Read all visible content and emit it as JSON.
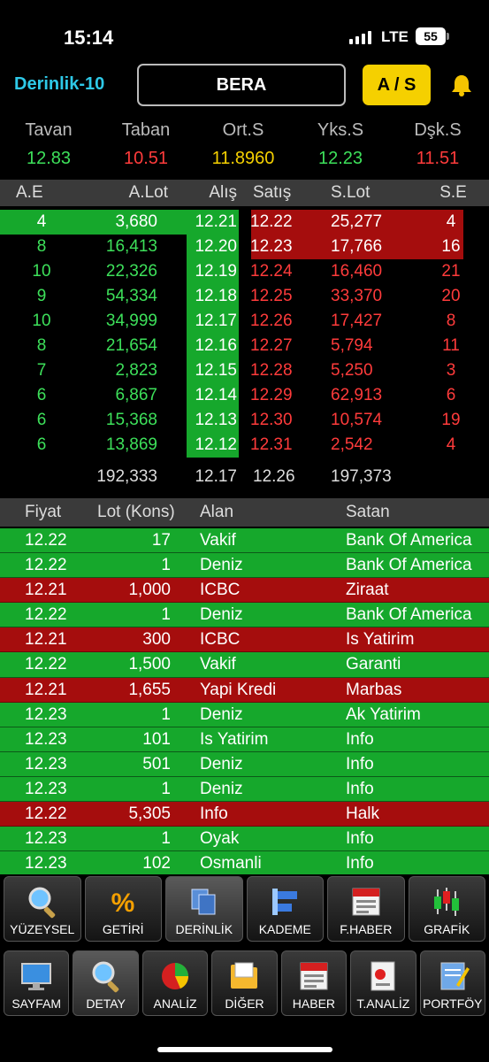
{
  "status": {
    "time": "15:14",
    "network": "LTE",
    "battery": "55"
  },
  "header": {
    "depth_label": "Derinlik-10",
    "symbol": "BERA",
    "buy_sell": "A / S"
  },
  "summary": [
    {
      "label": "Tavan",
      "value": "12.83",
      "color": "#3de05a"
    },
    {
      "label": "Taban",
      "value": "10.51",
      "color": "#ff3b3b"
    },
    {
      "label": "Ort.S",
      "value": "11.8960",
      "color": "#f5d000"
    },
    {
      "label": "Yks.S",
      "value": "12.23",
      "color": "#3de05a"
    },
    {
      "label": "Dşk.S",
      "value": "11.51",
      "color": "#ff3b3b"
    }
  ],
  "depth": {
    "headers": [
      "A.E",
      "A.Lot",
      "Alış",
      "Satış",
      "S.Lot",
      "S.E"
    ],
    "rows": [
      [
        "4",
        "3,680",
        "12.21",
        "12.22",
        "25,277",
        "4"
      ],
      [
        "8",
        "16,413",
        "12.20",
        "12.23",
        "17,766",
        "16"
      ],
      [
        "10",
        "22,326",
        "12.19",
        "12.24",
        "16,460",
        "21"
      ],
      [
        "9",
        "54,334",
        "12.18",
        "12.25",
        "33,370",
        "20"
      ],
      [
        "10",
        "34,999",
        "12.17",
        "12.26",
        "17,427",
        "8"
      ],
      [
        "8",
        "21,654",
        "12.16",
        "12.27",
        "5,794",
        "11"
      ],
      [
        "7",
        "2,823",
        "12.15",
        "12.28",
        "5,250",
        "3"
      ],
      [
        "6",
        "6,867",
        "12.14",
        "12.29",
        "62,913",
        "6"
      ],
      [
        "6",
        "15,368",
        "12.13",
        "12.30",
        "10,574",
        "19"
      ],
      [
        "6",
        "13,869",
        "12.12",
        "12.31",
        "2,542",
        "4"
      ]
    ],
    "bid_fill": [
      1.0,
      0.0,
      0,
      0,
      0,
      0,
      0,
      0,
      0,
      0
    ],
    "ask_fill": [
      1.0,
      1.0,
      0,
      0,
      0,
      0,
      0,
      0,
      0,
      0
    ],
    "totals": [
      "192,333",
      "12.17",
      "12.26",
      "197,373"
    ]
  },
  "trades": {
    "headers": [
      "Fiyat",
      "Lot (Kons)",
      "Alan",
      "Satan"
    ],
    "rows": [
      {
        "side": "buy",
        "price": "12.22",
        "lot": "17",
        "buyer": "Vakif",
        "seller": "Bank Of America"
      },
      {
        "side": "buy",
        "price": "12.22",
        "lot": "1",
        "buyer": "Deniz",
        "seller": "Bank Of America"
      },
      {
        "side": "sell",
        "price": "12.21",
        "lot": "1,000",
        "buyer": "ICBC",
        "seller": "Ziraat"
      },
      {
        "side": "buy",
        "price": "12.22",
        "lot": "1",
        "buyer": "Deniz",
        "seller": "Bank Of America"
      },
      {
        "side": "sell",
        "price": "12.21",
        "lot": "300",
        "buyer": "ICBC",
        "seller": "Is Yatirim"
      },
      {
        "side": "buy",
        "price": "12.22",
        "lot": "1,500",
        "buyer": "Vakif",
        "seller": "Garanti"
      },
      {
        "side": "sell",
        "price": "12.21",
        "lot": "1,655",
        "buyer": "Yapi Kredi",
        "seller": "Marbas"
      },
      {
        "side": "buy",
        "price": "12.23",
        "lot": "1",
        "buyer": "Deniz",
        "seller": "Ak Yatirim"
      },
      {
        "side": "buy",
        "price": "12.23",
        "lot": "101",
        "buyer": "Is Yatirim",
        "seller": "Info"
      },
      {
        "side": "buy",
        "price": "12.23",
        "lot": "501",
        "buyer": "Deniz",
        "seller": "Info"
      },
      {
        "side": "buy",
        "price": "12.23",
        "lot": "1",
        "buyer": "Deniz",
        "seller": "Info"
      },
      {
        "side": "sell",
        "price": "12.22",
        "lot": "5,305",
        "buyer": "Info",
        "seller": "Halk"
      },
      {
        "side": "buy",
        "price": "12.23",
        "lot": "1",
        "buyer": "Oyak",
        "seller": "Info"
      },
      {
        "side": "buy",
        "price": "12.23",
        "lot": "102",
        "buyer": "Osmanli",
        "seller": "Info"
      }
    ]
  },
  "toolbar1": [
    {
      "label": "YÜZEYSEL",
      "icon": "magnifier-icon"
    },
    {
      "label": "GETİRİ",
      "icon": "percent-icon"
    },
    {
      "label": "DERİNLİK",
      "icon": "depth-stack-icon",
      "active": true
    },
    {
      "label": "KADEME",
      "icon": "level-bars-icon"
    },
    {
      "label": "F.HABER",
      "icon": "newspaper-icon"
    },
    {
      "label": "GRAFİK",
      "icon": "candlestick-icon"
    }
  ],
  "toolbar2": [
    {
      "label": "SAYFAM",
      "icon": "monitor-icon"
    },
    {
      "label": "DETAY",
      "icon": "magnifier-icon",
      "active": true
    },
    {
      "label": "ANALİZ",
      "icon": "pie-chart-icon"
    },
    {
      "label": "DİĞER",
      "icon": "folder-icon"
    },
    {
      "label": "HABER",
      "icon": "newspaper-icon"
    },
    {
      "label": "T.ANALİZ",
      "icon": "report-icon"
    },
    {
      "label": "PORTFÖY",
      "icon": "notepad-icon"
    }
  ],
  "colors": {
    "green_text": "#3de05a",
    "red_text": "#ff3b3b",
    "bid_bg": "#16a82c",
    "ask_bg": "#a50d0d"
  }
}
